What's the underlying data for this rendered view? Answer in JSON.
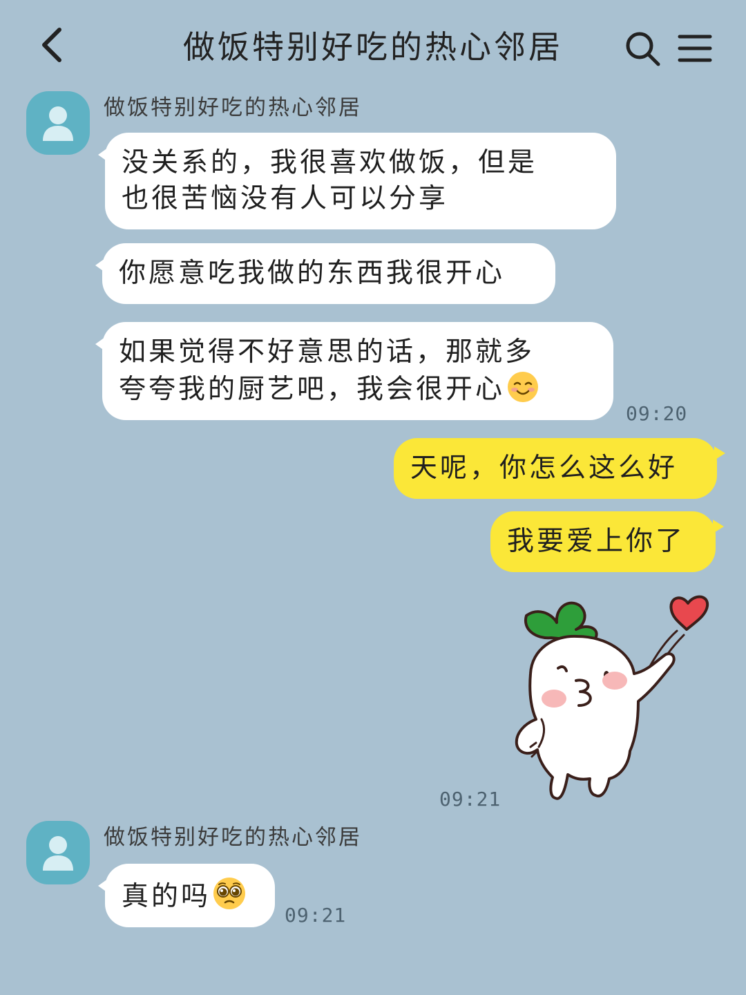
{
  "header": {
    "title": "做饭特别好吃的热心邻居",
    "back_icon": "chevron-left-icon",
    "search_icon": "search-icon",
    "menu_icon": "menu-icon"
  },
  "colors": {
    "background": "#a9c1d1",
    "incoming_bubble": "#ffffff",
    "outgoing_bubble": "#fbe738",
    "avatar": "#5fb2c4"
  },
  "messages": [
    {
      "sender": "做饭特别好吃的热心邻居",
      "direction": "in",
      "text": "没关系的，我很喜欢做饭，但是\n也很苦恼没有人可以分享"
    },
    {
      "direction": "in",
      "text": "你愿意吃我做的东西我很开心"
    },
    {
      "direction": "in",
      "text": "如果觉得不好意思的话，那就多\n夸夸我的厨艺吧，我会很开心",
      "emoji": "smiling-face-icon",
      "time": "09:20"
    },
    {
      "direction": "out",
      "text": "天呢，你怎么这么好"
    },
    {
      "direction": "out",
      "text": "我要爱上你了"
    },
    {
      "direction": "out",
      "sticker": "radish-kiss-sticker",
      "time": "09:21"
    },
    {
      "sender": "做饭特别好吃的热心邻居",
      "direction": "in",
      "text": "真的吗",
      "emoji": "pleading-face-icon",
      "time": "09:21"
    }
  ]
}
